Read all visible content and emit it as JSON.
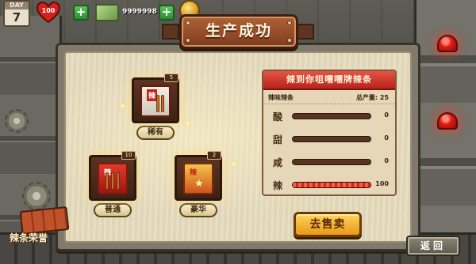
{
  "hud": {
    "day_label": "DAY",
    "day_value": "7",
    "health_value": "100",
    "money_value": "9999998",
    "add_symbol": "+"
  },
  "dialog": {
    "title": "生产成功"
  },
  "products": [
    {
      "name": "稀有",
      "count": "5",
      "pack_text": "辣"
    },
    {
      "name": "普通",
      "count": "10",
      "pack_text": "辣"
    },
    {
      "name": "豪华",
      "count": "2",
      "pack_text": "辣"
    }
  ],
  "stats": {
    "title": "辣到你咀嚅嚅牌辣条",
    "subtitle_left": "辣味辣条",
    "subtitle_right": "总产量: 25",
    "rows": [
      {
        "label": "酸",
        "value": "0",
        "fill": 0
      },
      {
        "label": "甜",
        "value": "0",
        "fill": 0
      },
      {
        "label": "咸",
        "value": "0",
        "fill": 0
      },
      {
        "label": "辣",
        "value": "100",
        "fill": 1.0
      }
    ]
  },
  "buttons": {
    "sell": "去售卖",
    "back": "返回"
  },
  "honor": {
    "label": "辣条荣誉"
  },
  "colors": {
    "accent_red": "#d3261a",
    "button_gold": "#e89a18",
    "title_brown": "#7d3c1e"
  }
}
